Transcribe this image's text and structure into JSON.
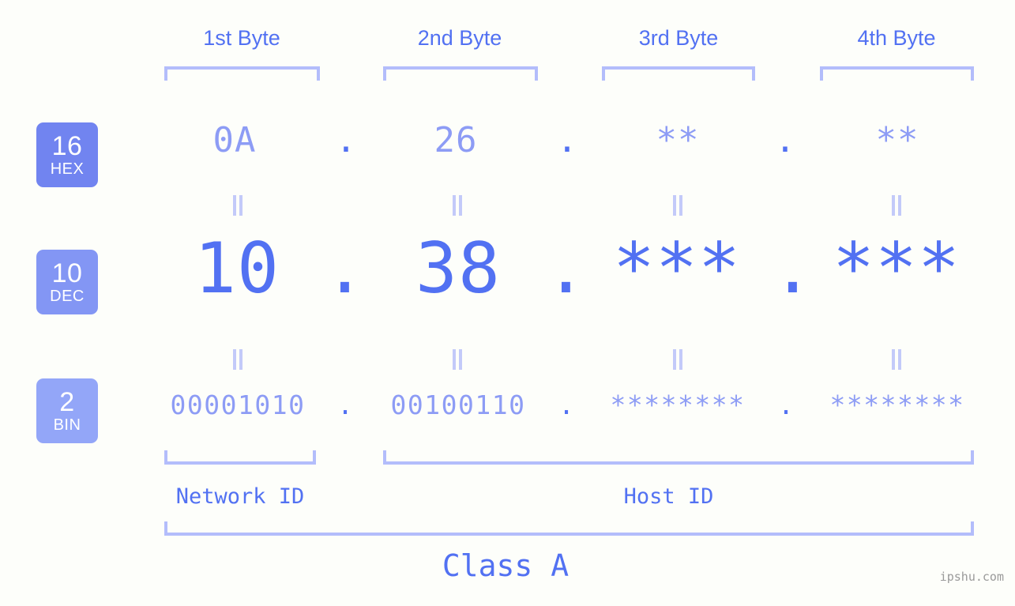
{
  "background_color": "#fdfefa",
  "accent_color": "#5271f2",
  "accent_light_color": "#8d9cf5",
  "bracket_color": "#b3bdfb",
  "connector_color": "#c3caf9",
  "header": {
    "byte_labels": [
      "1st Byte",
      "2nd Byte",
      "3rd Byte",
      "4th Byte"
    ]
  },
  "bases": [
    {
      "number": "16",
      "name": "HEX",
      "color": "#7184f0"
    },
    {
      "number": "10",
      "name": "DEC",
      "color": "#8396f4"
    },
    {
      "number": "2",
      "name": "BIN",
      "color": "#93a6f8"
    }
  ],
  "rows": {
    "hex": {
      "base_number": "16",
      "base_name": "HEX",
      "values": [
        "0A",
        "26",
        "**",
        "**"
      ],
      "separator": "."
    },
    "dec": {
      "base_number": "10",
      "base_name": "DEC",
      "values": [
        "10",
        "38",
        "***",
        "***"
      ],
      "separator": "."
    },
    "bin": {
      "base_number": "2",
      "base_name": "BIN",
      "values": [
        "00001010",
        "00100110",
        "********",
        "********"
      ],
      "separator": "."
    }
  },
  "connectors": {
    "symbol": "equals-vertical"
  },
  "footer": {
    "network_id_label": "Network ID",
    "host_id_label": "Host ID",
    "class_label": "Class A"
  },
  "watermark": "ipshu.com"
}
